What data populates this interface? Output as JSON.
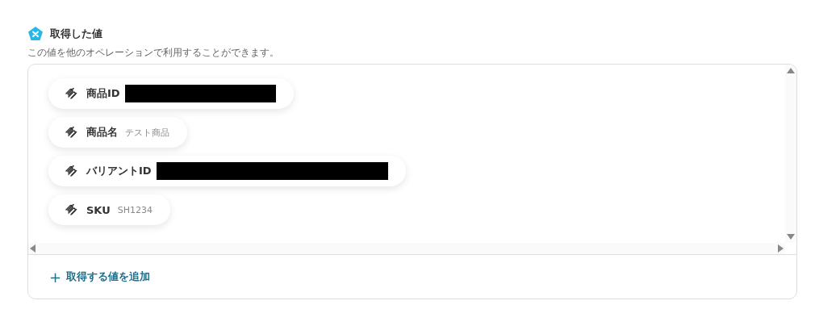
{
  "section": {
    "title": "取得した値",
    "description": "この値を他のオペレーションで利用することができます。"
  },
  "fields": [
    {
      "label": "商品ID",
      "redacted": true
    },
    {
      "label": "商品名",
      "value": "テスト商品",
      "redacted": false
    },
    {
      "label": "バリアントID",
      "redacted": true
    },
    {
      "label": "SKU",
      "value": "SH1234",
      "redacted": false
    }
  ],
  "add_button": {
    "icon": "+",
    "label": "取得する値を追加"
  }
}
